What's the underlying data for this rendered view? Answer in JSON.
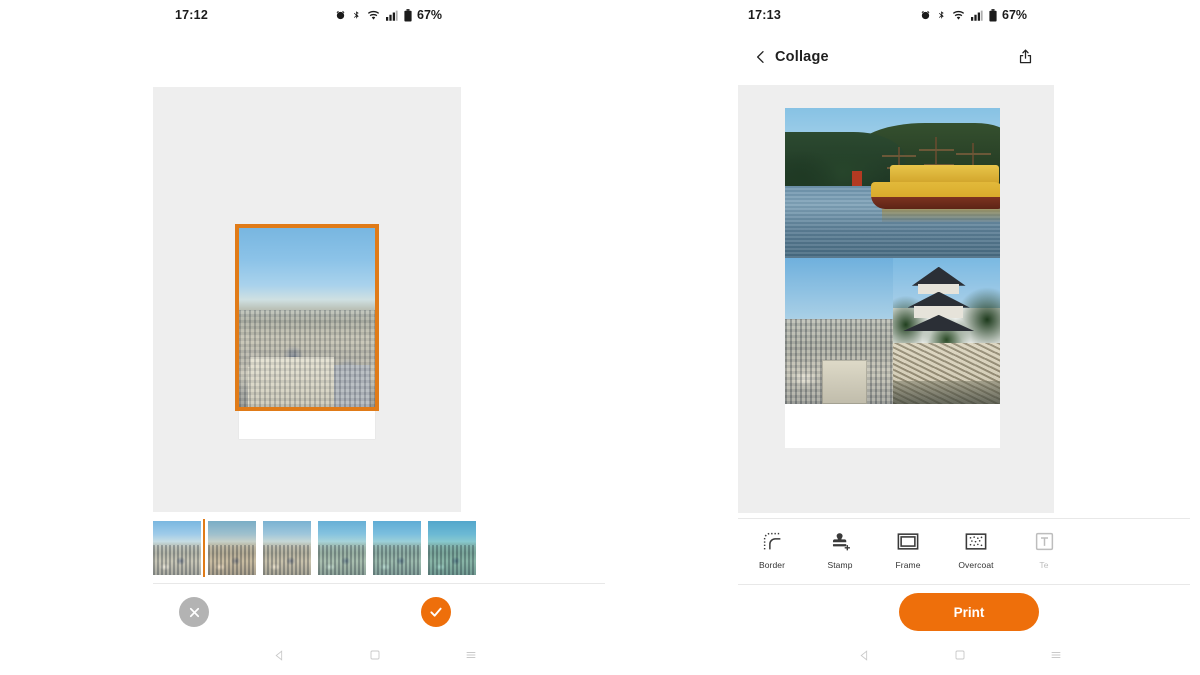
{
  "left_phone": {
    "status_bar": {
      "time": "17:12",
      "battery_text": "67%",
      "icons": [
        "alarm-icon",
        "bluetooth-icon",
        "wifi-icon",
        "cellular-signal-icon",
        "battery-icon"
      ]
    },
    "editor": {
      "selected_photo_name": "city-skyline-photo",
      "frame_style": "polaroid-white-border",
      "selection_color": "#e07b18"
    },
    "filters": [
      {
        "name": "original",
        "tint": "rgba(0,0,0,0)"
      },
      {
        "name": "warm",
        "tint": "rgba(255,190,120,0.22)"
      },
      {
        "name": "faded",
        "tint": "rgba(255,235,205,0.30)"
      },
      {
        "name": "cool",
        "tint": "rgba(110,220,215,0.28)"
      },
      {
        "name": "aqua",
        "tint": "rgba(90,210,220,0.34)"
      },
      {
        "name": "teal",
        "tint": "rgba(60,200,200,0.42)"
      }
    ],
    "actions": {
      "cancel_label": "cancel",
      "cancel_icon": "close-icon",
      "cancel_color": "#b3b3b3",
      "confirm_label": "confirm",
      "confirm_icon": "check-icon",
      "confirm_color": "#ee6f0b"
    },
    "nav_bar": [
      "back-triangle-icon",
      "home-square-icon",
      "recents-menu-icon"
    ]
  },
  "right_phone": {
    "status_bar": {
      "time": "17:13",
      "battery_text": "67%",
      "icons": [
        "alarm-icon",
        "bluetooth-icon",
        "wifi-icon",
        "cellular-signal-icon",
        "battery-icon"
      ]
    },
    "app_bar": {
      "back_icon": "chevron-left-icon",
      "title": "Collage",
      "share_icon": "share-icon"
    },
    "collage": {
      "layout": "one-top-two-bottom",
      "photos": [
        {
          "name": "lake-pirate-ship-photo",
          "position": "top"
        },
        {
          "name": "city-skyline-photo",
          "position": "bottom-left"
        },
        {
          "name": "castle-stone-wall-photo",
          "position": "bottom-right"
        }
      ],
      "frame_style": "polaroid-white-border"
    },
    "toolbar": [
      {
        "label": "Border",
        "icon": "border-corner-icon"
      },
      {
        "label": "Stamp",
        "icon": "stamp-plus-icon"
      },
      {
        "label": "Frame",
        "icon": "frame-rectangle-icon"
      },
      {
        "label": "Overcoat",
        "icon": "overcoat-dots-icon"
      },
      {
        "label": "Te",
        "icon": "text-icon"
      }
    ],
    "print_button": {
      "label": "Print",
      "color": "#ee6f0b"
    },
    "nav_bar": [
      "back-triangle-icon",
      "home-square-icon",
      "recents-menu-icon"
    ]
  }
}
